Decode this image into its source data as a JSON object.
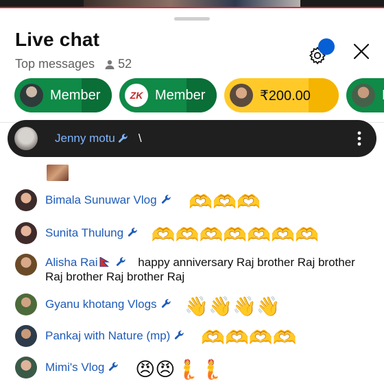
{
  "header": {
    "title": "Live chat",
    "mode": "Top messages",
    "viewer_count": "52"
  },
  "chips": [
    {
      "label": "Member",
      "style": "green"
    },
    {
      "label": "Member",
      "style": "green"
    },
    {
      "label": "₹200.00",
      "style": "yellow"
    },
    {
      "label": "N",
      "style": "green"
    }
  ],
  "chip_brand": "ZK",
  "pinned": {
    "author": "Jenny motu",
    "text": "\\"
  },
  "messages": [
    {
      "author": "Bimala Sunuwar Vlog",
      "text": "",
      "emoji": "🫶🫶🫶"
    },
    {
      "author": "Sunita Thulung",
      "text": "",
      "emoji": "🫶🫶🫶🫶🫶🫶🫶"
    },
    {
      "author": "Alisha Rai",
      "text": "happy anniversary Raj brother Raj brother Raj brother Raj brother Raj",
      "emoji": ""
    },
    {
      "author": "Gyanu khotang Vlogs",
      "text": "",
      "emoji": "👋👋👋👋"
    },
    {
      "author": "Pankaj with Nature (mp)",
      "text": "",
      "emoji": "🫶🫶🫶🫶"
    },
    {
      "author": "Mimi's Vlog",
      "text": "",
      "emoji": "😠😠🧜🧜"
    }
  ],
  "colors": {
    "author_link": "#1e5bb8",
    "member_green": "#0f8a47",
    "superchat_yellow": "#ffca28",
    "notification_dot": "#065fd4"
  }
}
